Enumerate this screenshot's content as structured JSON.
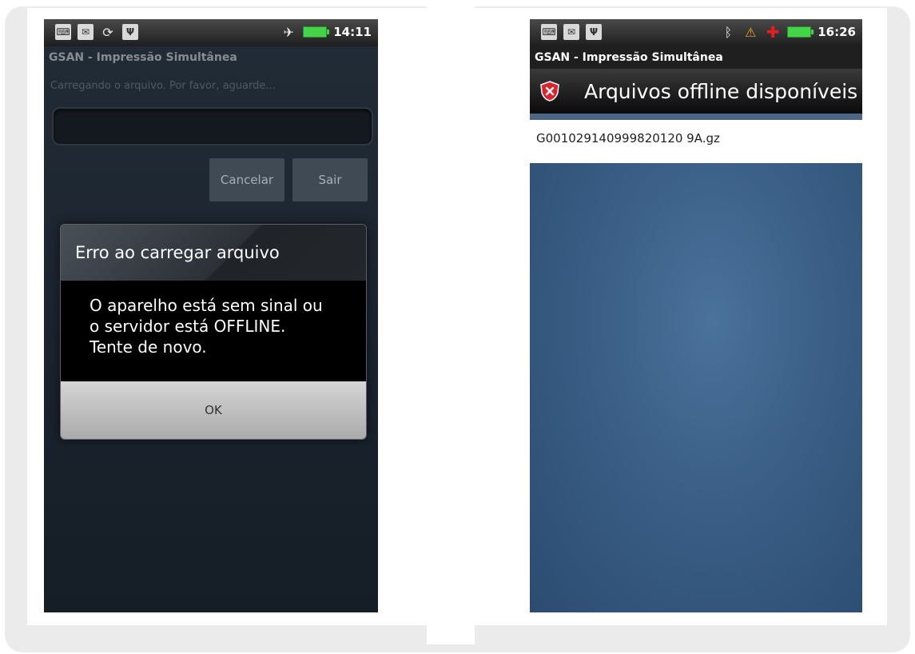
{
  "left_screen": {
    "status_time": "14:11",
    "app_title": "GSAN - Impressão Simultânea",
    "loading_text": "Carregando o arquivo. Por favor, aguarde...",
    "buttons": {
      "cancel": "Cancelar",
      "exit": "Sair"
    },
    "dialog": {
      "title": "Erro ao carregar arquivo",
      "message_lines": [
        "O aparelho está sem sinal ou",
        "o servidor está OFFLINE.",
        "Tente de novo."
      ],
      "ok": "OK"
    }
  },
  "right_screen": {
    "status_time": "16:26",
    "app_title": "GSAN - Impressão Simultânea",
    "header": "Arquivos offline disponíveis",
    "files": [
      "G001029140999820120 9A.gz"
    ]
  },
  "colors": {
    "battery": "#46d34a",
    "screen_bg_left": "#1c2530",
    "list_bg_right": "#3a5e86",
    "error_icon": "#d9232e"
  }
}
